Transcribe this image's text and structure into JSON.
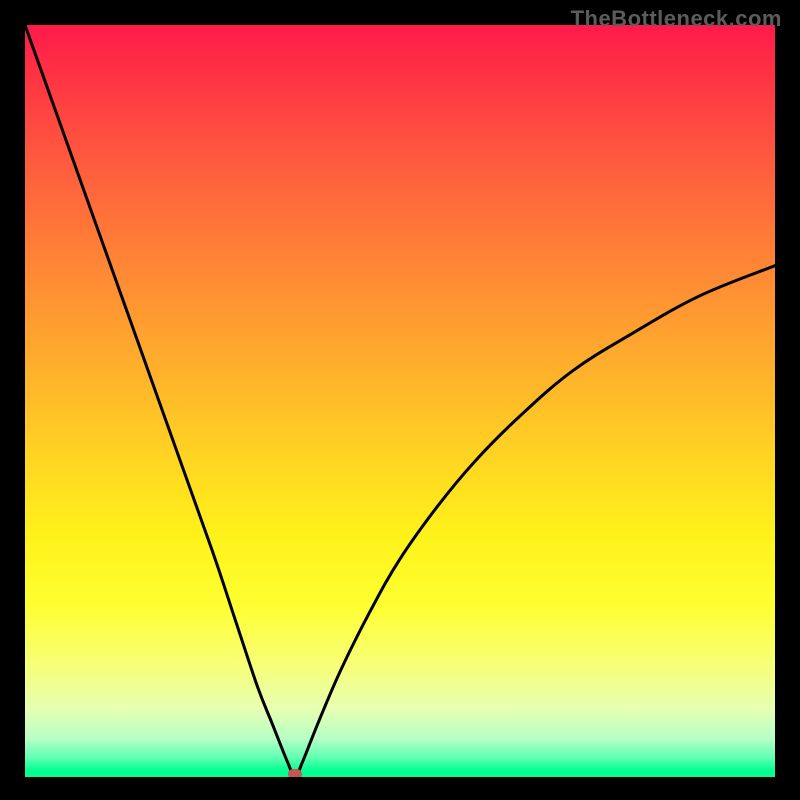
{
  "watermark": "TheBottleneck.com",
  "colors": {
    "page_bg": "#000000",
    "curve": "#000000",
    "marker": "#c55553",
    "gradient_top": "#ff1a4b",
    "gradient_bottom": "#00ff90"
  },
  "chart_data": {
    "type": "line",
    "title": "",
    "xlabel": "",
    "ylabel": "",
    "xlim": [
      0,
      100
    ],
    "ylim": [
      0,
      100
    ],
    "grid": false,
    "legend": false,
    "note": "V-shaped bottleneck curve over vertical red→green gradient. Lower y = better (green). Minimum ≈ x 36, y 0.",
    "series": [
      {
        "name": "bottleneck",
        "x": [
          0,
          5,
          10,
          15,
          20,
          25,
          28,
          31,
          33,
          35,
          36,
          37,
          39,
          42,
          46,
          50,
          55,
          60,
          66,
          73,
          81,
          90,
          100
        ],
        "values": [
          100,
          86,
          72,
          58,
          44,
          30,
          21,
          12,
          7,
          2,
          0,
          2,
          7,
          14,
          22,
          29,
          36,
          42,
          48,
          54,
          59,
          64,
          68
        ]
      }
    ],
    "min_point": {
      "x": 36,
      "y": 0
    }
  }
}
